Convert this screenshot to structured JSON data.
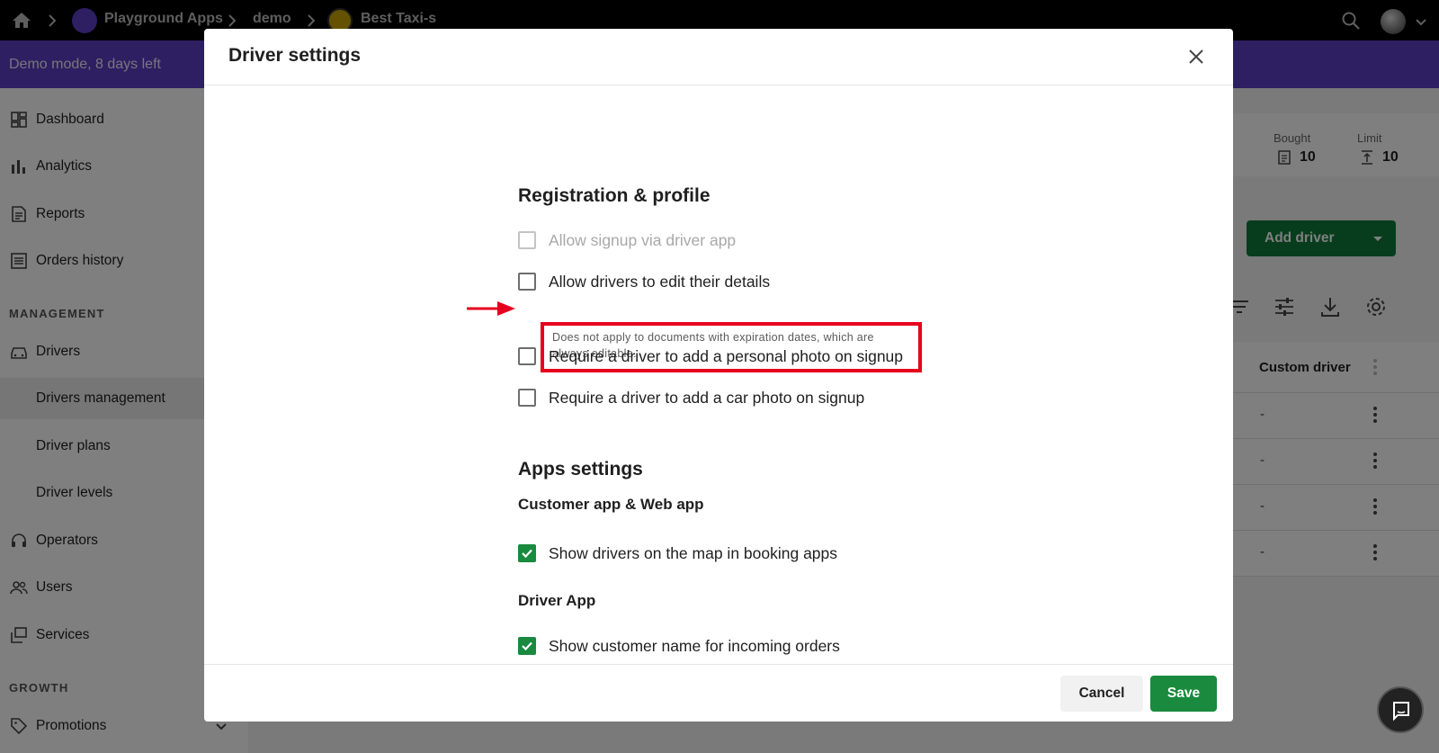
{
  "topbar": {
    "crumbs": [
      "Playground Apps",
      "demo",
      "Best Taxi-s"
    ]
  },
  "demo_banner": "Demo mode, 8 days left",
  "sidebar": {
    "items": [
      {
        "label": "Dashboard",
        "icon": "dashboard-icon"
      },
      {
        "label": "Analytics",
        "icon": "analytics-icon"
      },
      {
        "label": "Reports",
        "icon": "reports-icon"
      },
      {
        "label": "Orders history",
        "icon": "orders-history-icon"
      }
    ],
    "management_heading": "MANAGEMENT",
    "management_items": [
      {
        "label": "Drivers",
        "icon": "car-icon"
      },
      {
        "label": "Drivers management"
      },
      {
        "label": "Driver plans"
      },
      {
        "label": "Driver levels"
      },
      {
        "label": "Operators",
        "icon": "headset-icon"
      },
      {
        "label": "Users",
        "icon": "users-icon"
      },
      {
        "label": "Services",
        "icon": "services-icon"
      }
    ],
    "growth_heading": "GROWTH",
    "growth_items": [
      {
        "label": "Promotions",
        "icon": "tag-icon"
      }
    ]
  },
  "background": {
    "stats": [
      {
        "label": "Bought",
        "value": "10"
      },
      {
        "label": "Limit",
        "value": "10"
      }
    ],
    "add_driver_label": "Add driver",
    "table_header": "Custom driver",
    "rows": [
      "-",
      "-",
      "-",
      "-"
    ]
  },
  "modal": {
    "title": "Driver settings",
    "registration": {
      "title": "Registration & profile",
      "options": [
        {
          "label": "Allow signup via driver app",
          "checked": false,
          "disabled": true
        },
        {
          "label": "Allow drivers to edit their details",
          "checked": false,
          "disabled": false
        },
        {
          "label": "Require a driver to add a personal photo on signup",
          "checked": false,
          "disabled": false
        },
        {
          "label": "Require a driver to add a car photo on signup",
          "checked": false,
          "disabled": false
        }
      ],
      "hint": "Does not apply to documents with expiration dates, which are always editable."
    },
    "apps": {
      "title": "Apps settings",
      "customer_subtitle": "Customer app & Web app",
      "customer_option": {
        "label": "Show drivers on the map in booking apps",
        "checked": true
      },
      "driver_subtitle": "Driver App",
      "driver_option": {
        "label": "Show customer name for incoming orders",
        "checked": true
      }
    },
    "cancel_label": "Cancel",
    "save_label": "Save"
  },
  "colors": {
    "accent_green": "#1a8a3e",
    "demo_purple": "#5b3fc4",
    "highlight_red": "#e6001e"
  }
}
